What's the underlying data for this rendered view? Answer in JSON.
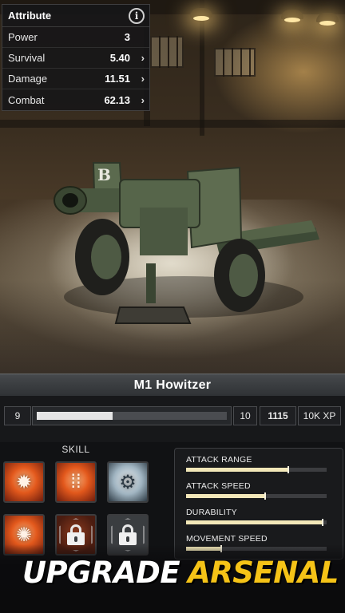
{
  "attributes": {
    "title": "Attribute",
    "info_icon": "info-icon",
    "rows": [
      {
        "name": "Power",
        "value": "3",
        "has_arrow": false
      },
      {
        "name": "Survival",
        "value": "5.40",
        "has_arrow": true
      },
      {
        "name": "Damage",
        "value": "11.51",
        "has_arrow": true
      },
      {
        "name": "Combat",
        "value": "62.13",
        "has_arrow": true
      }
    ],
    "arrow_glyph": "›"
  },
  "vehicle": {
    "name": "M1 Howitzer",
    "marking": "B"
  },
  "level": {
    "current": "9",
    "next": "10",
    "xp_current": "1115",
    "xp_required": "10K XP",
    "progress": 0.4
  },
  "skills": {
    "label": "SKILL",
    "slots": [
      {
        "icon": "bomb-icon",
        "state": "unlocked"
      },
      {
        "icon": "bullets-icon",
        "state": "unlocked"
      },
      {
        "icon": "engine-icon",
        "state": "unlocked"
      },
      {
        "icon": "explosion-icon",
        "state": "unlocked"
      },
      {
        "icon": "lock-icon",
        "state": "locked"
      },
      {
        "icon": "lock-icon",
        "state": "locked"
      }
    ]
  },
  "stats": [
    {
      "label": "ATTACK RANGE",
      "value": 0.73
    },
    {
      "label": "ATTACK SPEED",
      "value": 0.56
    },
    {
      "label": "DURABILITY",
      "value": 0.97
    },
    {
      "label": "MOVEMENT SPEED",
      "value": 0.25
    }
  ],
  "banner": {
    "word1": "UPGRADE",
    "word2": "ARSENAL"
  },
  "colors": {
    "accent": "#f5c317",
    "stat_fill": "#f2e7b8",
    "xp_fill": "#e5e5e5"
  }
}
